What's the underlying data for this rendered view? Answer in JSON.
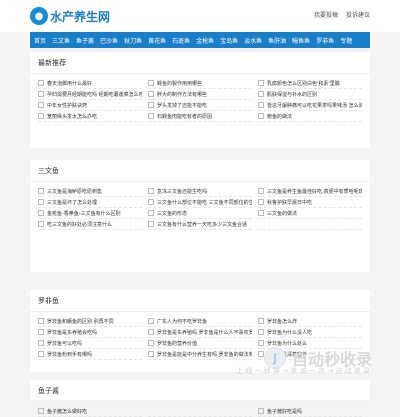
{
  "header": {
    "logo_icon": "fish-icon",
    "logo_text": "水产养生网",
    "links": [
      "我要投稿",
      "投诉建议"
    ]
  },
  "nav": {
    "items": [
      "首页",
      "三文鱼",
      "鱼子酱",
      "巴沙鱼",
      "秋刀鱼",
      "黄花鱼",
      "石斑鱼",
      "金枪鱼",
      "宝岛鱼",
      "淡水鱼",
      "鱼肝油",
      "鳗鱼鱼",
      "罗非鱼",
      "专题"
    ]
  },
  "sections": [
    {
      "title": "最新推荐",
      "items": [
        "春天泡脚用什么最好",
        "鳗鱼的製作用用哪些",
        "乳腐颜色怎么区别白色'和素'里腺",
        "孕妇需要月经期能吃吗 经期吃薯莲菜怎么吃",
        "胖大的制作方法有哪些",
        "肌肤保湿与补水的区别",
        "中年女性护肤诀窍",
        "罗头发掉了还能不能吃",
        "皆这牙龈肿痛可以吃花果茶吗果味汤 怎么消肿效果",
        "宽丽缘头发太怎么办吃",
        "石鳗鱼肉能吃有者的原因",
        "鲍鱼的做法"
      ]
    },
    {
      "title": "三文鱼",
      "items": [
        "三文鱼是海鲈原吃原到售",
        "急冻三文鱼还能生吃吗",
        "三文鱼是养生鱼最佳好吃,真便中有质哈呢现资好",
        "三文鱼是坏了怎么处理",
        "三文鱼什么部位不能吃 三文鱼不同部位的生吃方法",
        "秋鲁护肤早晨日中吃",
        "金枪鱼-香拳鱼-三文鱼有什么区别",
        "三文鱼的形态",
        "三文鱼的做法",
        "吃三文鱼的好处必须注意什么",
        "三文鱼有什么营养一天吃多少三文鱼合适",
        ""
      ]
    },
    {
      "title": "罗非鱼",
      "items": [
        "罗非鱼和鳜鱼的区别 别再不同",
        "广东人为何不吃罗非鱼",
        "罗非鱼怎么炸",
        "罗非鱼是东养殖会吃吗",
        "罗非鱼是东养殖吗 罗非鱼是什么人不喜欢罗非鱼",
        "罗非鱼为什么没人吃",
        "罗非鱼可以吃吗",
        "罗非鱼的营养价值",
        "罗非鱼为什么处么",
        "罗非鱼粉到手有哪吗",
        "罗非鱼是能是中分养生有吗 罗非鱼的做法有哪些",
        "罗非鱼是清蒸营养"
      ]
    },
    {
      "title": "鱼子酱",
      "items": [
        "鱼子酱怎么做好吃",
        "",
        "鱼子酱好吃是吗"
      ]
    }
  ],
  "watermark": {
    "icon": "jn-logo-icon",
    "title": "自动秒收录",
    "subtitle": "上 线 一 秒 钟 → 来 访 一 次 → 自 动 收 录"
  }
}
